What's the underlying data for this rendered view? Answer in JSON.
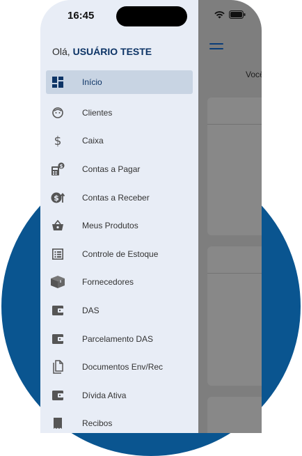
{
  "status_bar": {
    "time": "16:45"
  },
  "drawer": {
    "greeting_prefix": "Olá,",
    "user_name": "USUÁRIO TESTE",
    "items": [
      {
        "label": "Início",
        "icon": "dashboard-icon",
        "active": true
      },
      {
        "label": "Clientes",
        "icon": "face-icon"
      },
      {
        "label": "Caixa",
        "icon": "dollar-icon"
      },
      {
        "label": "Contas a Pagar",
        "icon": "calculator-money-icon"
      },
      {
        "label": "Contas a Receber",
        "icon": "coin-arrow-icon"
      },
      {
        "label": "Meus Produtos",
        "icon": "basket-icon"
      },
      {
        "label": "Controle de Estoque",
        "icon": "list-icon"
      },
      {
        "label": "Fornecedores",
        "icon": "box-icon"
      },
      {
        "label": "DAS",
        "icon": "wallet-icon"
      },
      {
        "label": "Parcelamento DAS",
        "icon": "wallet-icon"
      },
      {
        "label": "Documentos Env/Rec",
        "icon": "documents-icon"
      },
      {
        "label": "Dívida Ativa",
        "icon": "wallet-icon"
      },
      {
        "label": "Recibos",
        "icon": "receipt-icon"
      }
    ]
  },
  "main": {
    "partial_text": "Você"
  },
  "colors": {
    "accent": "#0d3466",
    "circle": "#0a5590",
    "drawer_bg": "#e8edf6",
    "active_bg": "#c8d4e3"
  }
}
